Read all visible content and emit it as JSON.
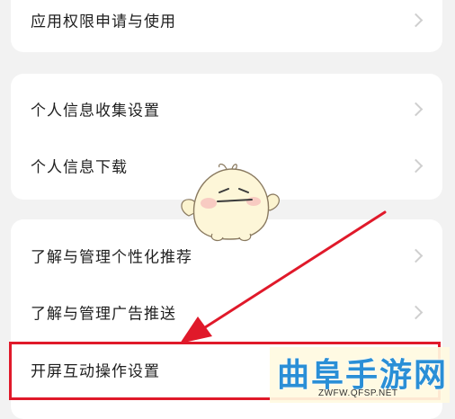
{
  "sections": [
    {
      "items": [
        {
          "label": "应用权限申请与使用"
        }
      ]
    },
    {
      "items": [
        {
          "label": "个人信息收集设置"
        },
        {
          "label": "个人信息下载"
        }
      ]
    },
    {
      "items": [
        {
          "label": "了解与管理个性化推荐"
        },
        {
          "label": "了解与管理广告推送"
        },
        {
          "label": "开屏互动操作设置"
        }
      ]
    }
  ],
  "annotation": {
    "highlight_color": "#e0192a",
    "arrow_color": "#e0192a",
    "highlighted_item": "开屏互动操作设置"
  },
  "watermark": {
    "title": "曲阜手游网",
    "url": "ZWFW.QFSP.NET"
  },
  "colors": {
    "background": "#f2f2f2",
    "card": "#ffffff",
    "text": "#1f1f1f",
    "chevron": "#cfcfcf"
  }
}
